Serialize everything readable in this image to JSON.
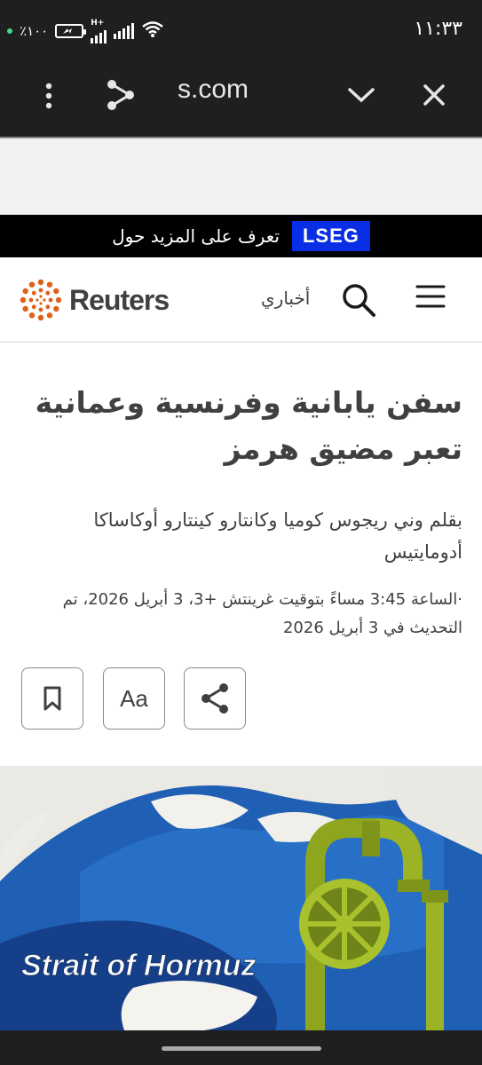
{
  "status_bar": {
    "time": "١١:٣٣",
    "battery_percent": "٪١٠٠",
    "network_label": "H+"
  },
  "browser": {
    "url_fragment": "s.com",
    "icons": [
      "more-vert-icon",
      "share-icon",
      "chevron-down-icon",
      "close-icon"
    ]
  },
  "banner": {
    "badge": "LSEG",
    "text": "تعرف على المزيد حول",
    "badge_color": "#0a2ee6"
  },
  "header": {
    "logo_text": "Reuters",
    "my_news": "أخباري",
    "icons": [
      "search-icon",
      "menu-icon"
    ],
    "logo_color": "#e05f19"
  },
  "article": {
    "headline": "سفن يابانية وفرنسية وعمانية تعبر مضيق هرمز",
    "byline": "بقلم وني ريجوس كوميا وكانتارو كينتارو أوكاساكا أدومايتيس",
    "timestamp": "·الساعة 3:45 مساءً بتوقيت غرينتش +3، 3 أبريل 2026، تم التحديث في 3 أبريل 2026",
    "actions": [
      "bookmark-icon",
      "Aa",
      "share-icon"
    ]
  },
  "hero_image": {
    "caption_text": "Strait of Hormuz"
  }
}
